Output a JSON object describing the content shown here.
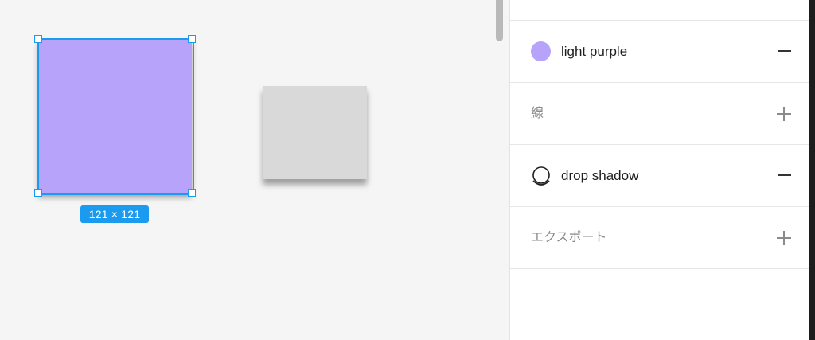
{
  "canvas": {
    "selection_size": "121 × 121",
    "selected_shape_fill": "#b7a3fa",
    "other_shape_fill": "#d9d9d9",
    "selection_color": "#1a9bf0"
  },
  "panel": {
    "fill": {
      "label": "light purple",
      "swatch_color": "#b7a3fa",
      "action": "minus-icon"
    },
    "stroke": {
      "label": "線",
      "action": "plus-icon"
    },
    "effect": {
      "label": "drop shadow",
      "icon": "drop-shadow-icon",
      "action": "minus-icon"
    },
    "export": {
      "label": "エクスポート",
      "action": "plus-icon"
    }
  }
}
